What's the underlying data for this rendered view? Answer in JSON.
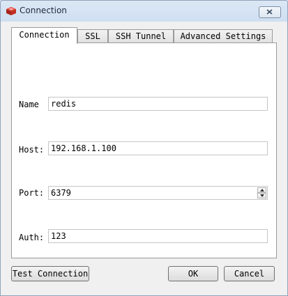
{
  "window": {
    "title": "Connection"
  },
  "tabs": [
    {
      "label": "Connection"
    },
    {
      "label": "SSL"
    },
    {
      "label": "SSH Tunnel"
    },
    {
      "label": "Advanced Settings"
    }
  ],
  "form": {
    "name": {
      "label": "Name",
      "value": "redis"
    },
    "host": {
      "label": "Host:",
      "value": "192.168.1.100"
    },
    "port": {
      "label": "Port:",
      "value": "6379"
    },
    "auth": {
      "label": "Auth:",
      "value": "123"
    }
  },
  "buttons": {
    "test": "Test Connection",
    "ok": "OK",
    "cancel": "Cancel"
  },
  "icons": {
    "app": "redis-logo-icon",
    "close": "close-icon",
    "spin_up": "chevron-up-icon",
    "spin_down": "chevron-down-icon"
  },
  "colors": {
    "brand": "#d82c20"
  }
}
